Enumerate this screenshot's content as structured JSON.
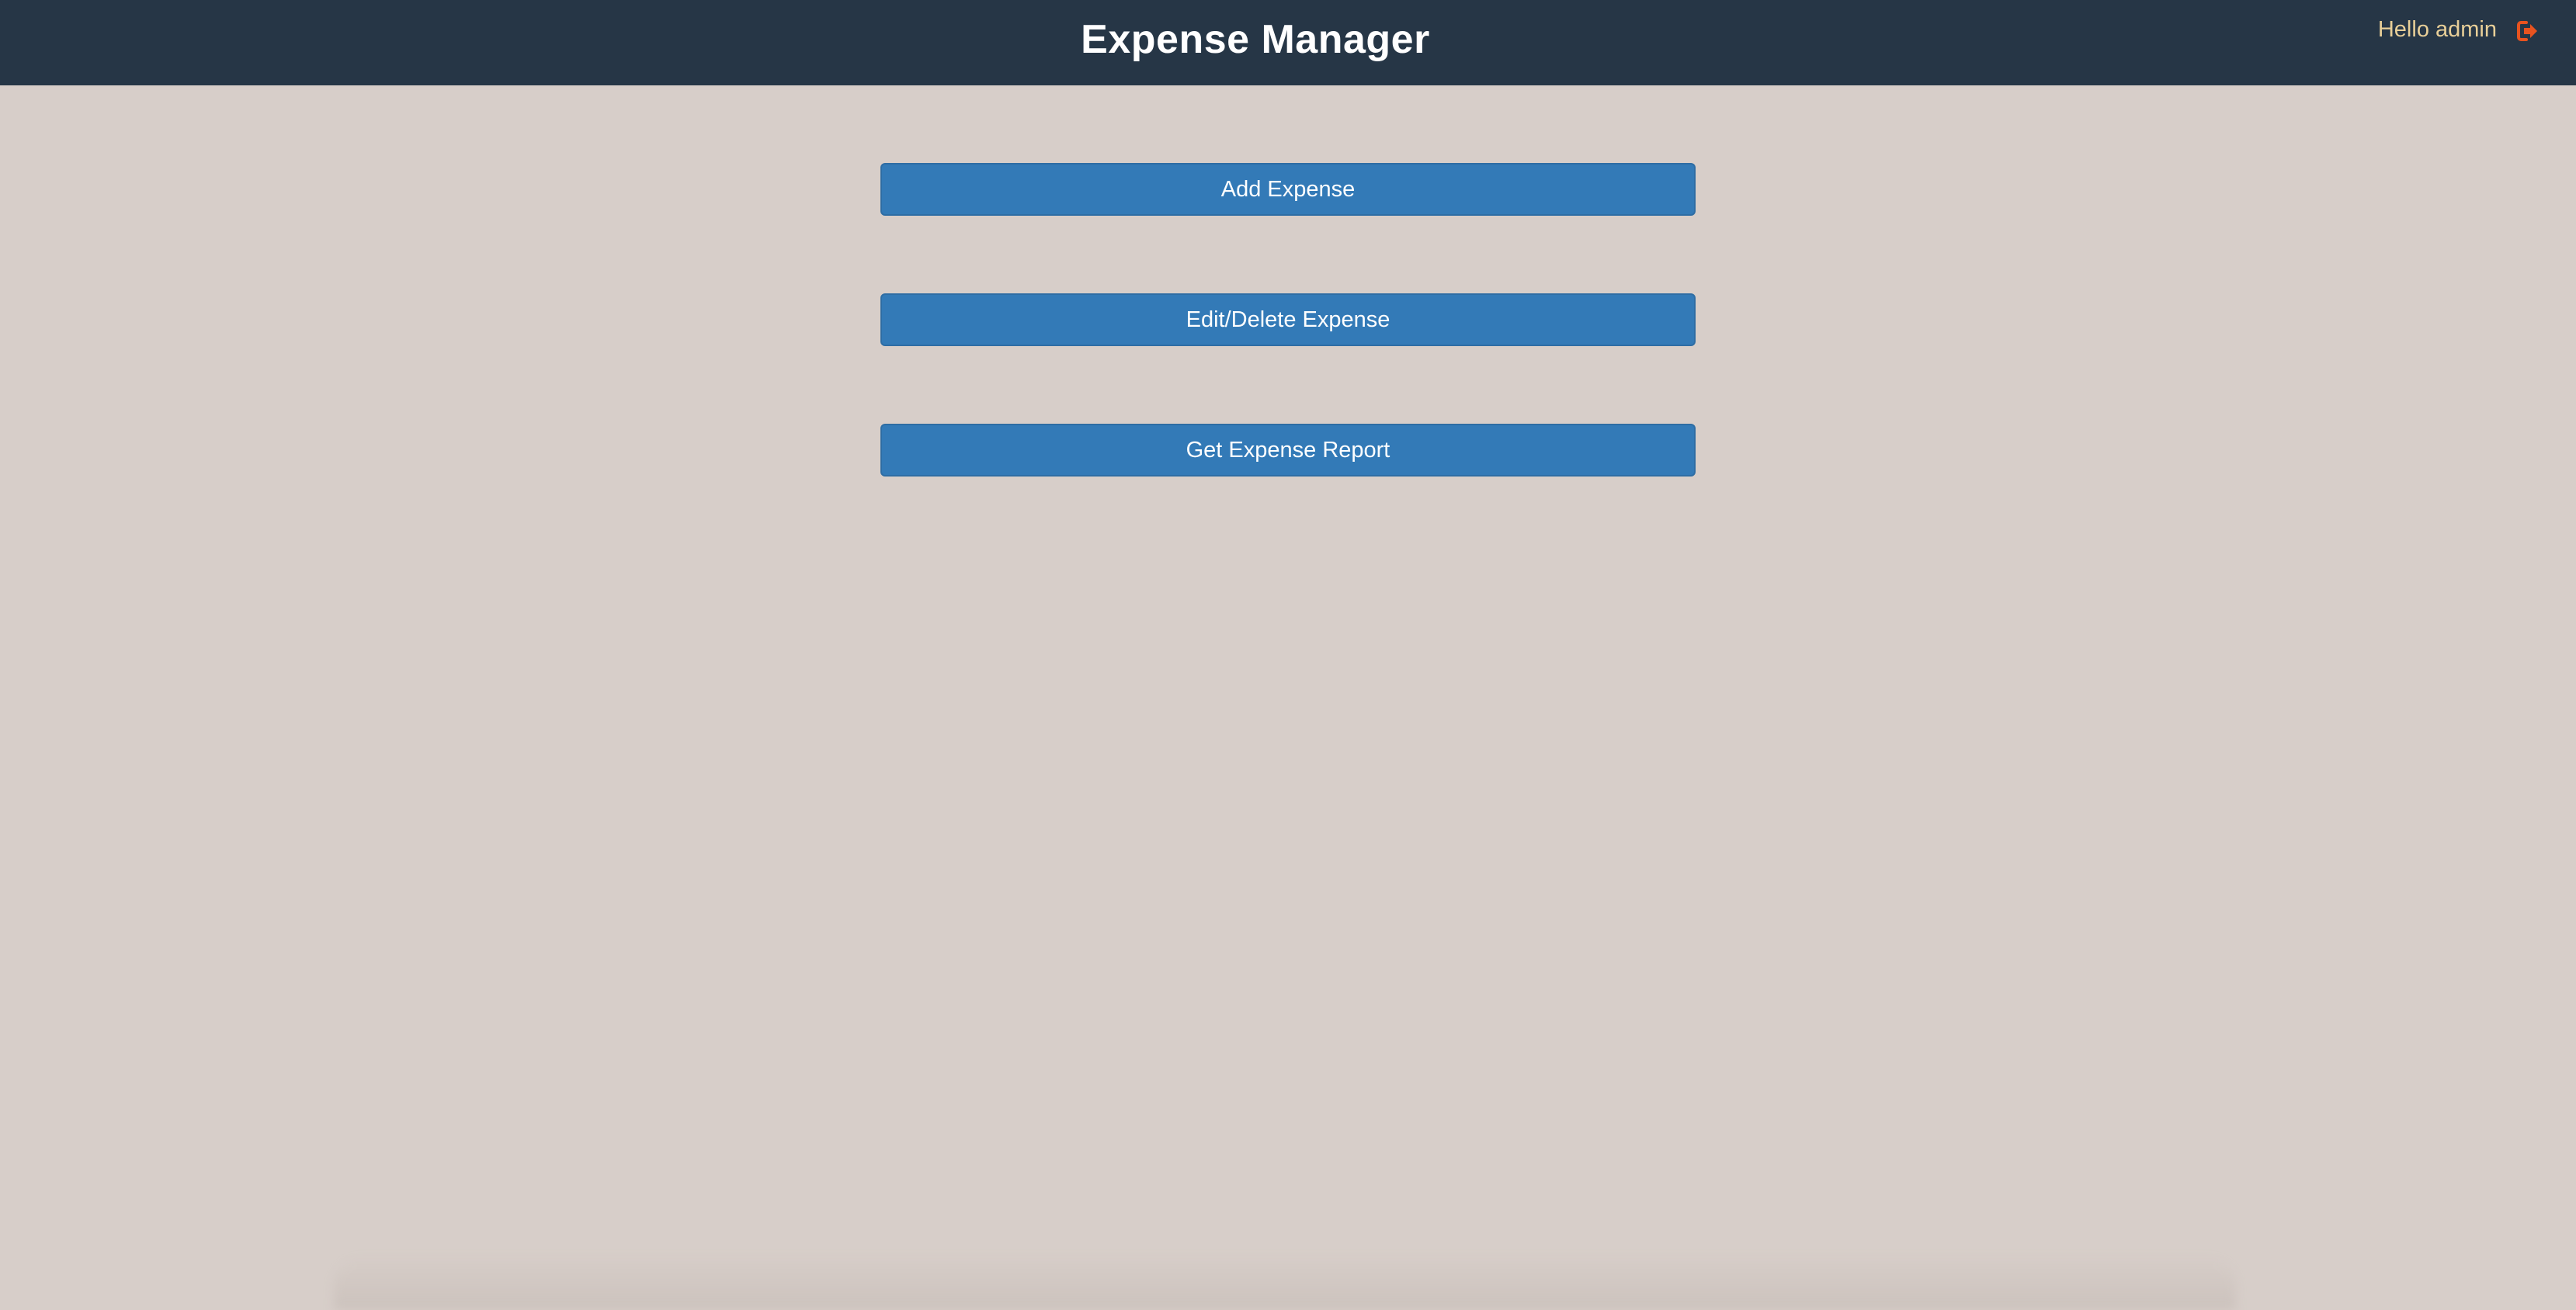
{
  "header": {
    "title": "Expense Manager",
    "greeting": "Hello admin",
    "logout_icon": "logout-icon"
  },
  "menu": {
    "buttons": [
      {
        "label": "Add Expense"
      },
      {
        "label": "Edit/Delete Expense"
      },
      {
        "label": "Get Expense Report"
      }
    ]
  },
  "colors": {
    "header_bg": "#263646",
    "page_bg": "#d7cec9",
    "button_bg": "#337ab7",
    "greeting_text": "#e8cf98",
    "logout_icon": "#e8531f"
  }
}
